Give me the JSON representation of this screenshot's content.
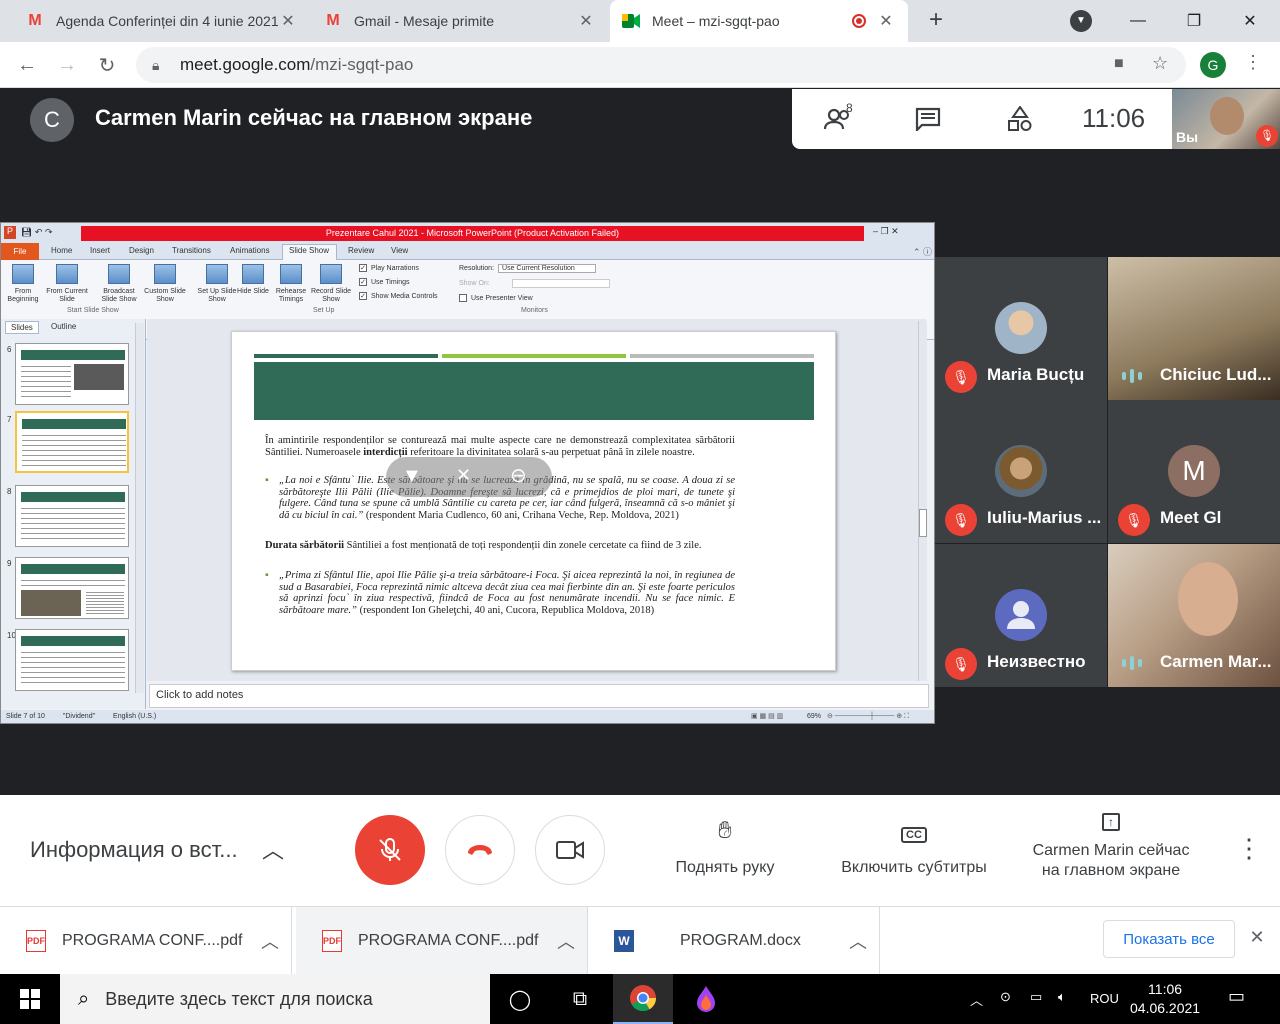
{
  "browser": {
    "tabs": [
      {
        "title": "Agenda Conferinței din 4 iunie 2021",
        "icon": "gmail-icon"
      },
      {
        "title": "Gmail - Mesaje primite",
        "icon": "gmail-icon"
      },
      {
        "title": "Meet – mzi-sgqt-pao",
        "icon": "meet-icon",
        "active": true
      }
    ],
    "new_tab": "+",
    "url_host": "meet.google.com",
    "url_path": "/mzi-sgqt-pao",
    "profile_initial": "G"
  },
  "meet": {
    "presenter_initial": "C",
    "presenter_title": "Carmen Marin сейчас на главном экране",
    "participants_count": "8",
    "clock": "11:06",
    "self_label": "Вы",
    "tiles": [
      {
        "name": "Maria Bucțu",
        "muted": true
      },
      {
        "name": "Chiciuc Lud...",
        "muted": false
      },
      {
        "name": "Iuliu-Marius ...",
        "muted": true
      },
      {
        "name": "Meet Gl",
        "initial": "M",
        "muted": true
      },
      {
        "name": "Неизвестно",
        "muted": true
      },
      {
        "name": "Carmen Mar...",
        "muted": false
      }
    ],
    "bottom": {
      "meeting_info": "Информация о вст...",
      "raise_hand": "Поднять руку",
      "captions": "Включить субтитры",
      "presenting": "Carmen Marin сейчас на главном экране"
    }
  },
  "ppt": {
    "title": "Prezentare Cahul 2021 - Microsoft PowerPoint (Product Activation Failed)",
    "file_tab": "File",
    "tabs": [
      "Home",
      "Insert",
      "Design",
      "Transitions",
      "Animations",
      "Slide Show",
      "Review",
      "View"
    ],
    "ribbon": {
      "from_beginning": "From Beginning",
      "from_current": "From Current Slide",
      "broadcast": "Broadcast Slide Show",
      "custom": "Custom Slide Show",
      "group_start": "Start Slide Show",
      "setup": "Set Up Slide Show",
      "hide": "Hide Slide",
      "rehearse": "Rehearse Timings",
      "record": "Record Slide Show",
      "play_narrations": "Play Narrations",
      "use_timings": "Use Timings",
      "show_media": "Show Media Controls",
      "group_setup": "Set Up",
      "resolution_label": "Resolution:",
      "resolution_value": "Use Current Resolution",
      "show_on": "Show On:",
      "presenter_view": "Use Presenter View",
      "group_monitors": "Monitors"
    },
    "panel_tabs": [
      "Slides",
      "Outline"
    ],
    "thumb_numbers": [
      "6",
      "7",
      "8",
      "9",
      "10"
    ],
    "slide": {
      "intro_before": "În amintirile respondenților se conturează mai multe aspecte care ne demonstrează complexitatea sărbătorii Sântiliei. Numeroasele ",
      "intro_bold": "interdicții",
      "intro_after": " referitoare la divinitatea solară s-au perpetuat până în zilele noastre.",
      "quote1": "„La noi e Sfântu` Ilie. Este sărbătoare şi nu se lucrează în grădină, nu se spală, nu se coase. A doua zi se sărbătoreşte Ilii Pălii (Ilie Pălie). Doamne fereşte să lucrezi, că e primejdios de ploi mari, de tunete şi fulgere. Când tuna se spune că umblă Sântilie cu careta pe cer, iar când fulgeră, înseamnă că s-o mâniet şi dă cu biciul în cai.”",
      "quote1_src": " (respondent Maria Cudlenco, 60 ani, Crihana Veche, Rep. Moldova, 2021)",
      "duration_bold": "Durata sărbătorii",
      "duration_text": " Sântiliei a fost menționată de toți respondenții din zonele cercetate ca fiind de 3 zile.",
      "quote2": "„Prima zi Sfântul Ilie, apoi Ilie Pălie şi-a treia sărbătoare-i Foca. Şi aicea reprezintă la noi, în regiunea de sud a Basarabiei, Foca reprezintă nimic altceva decât ziua cea mai fierbinte din an. Şi este foarte periculos să aprinzi focu` în ziua respectivă, fiindcă de Foca au fost nenumărate incendii. Nu se face nimic. E sărbătoare mare.”",
      "quote2_src": " (respondent Ion Gheleţchi, 40 ani, Cucora, Republica Moldova, 2018)"
    },
    "notes_placeholder": "Click to add notes",
    "status_slide": "Slide 7 of 10",
    "status_theme": "\"Dividend\"",
    "status_lang": "English (U.S.)",
    "status_zoom": "69%",
    "colors": {
      "title_bar": "#e81123",
      "slide_header": "#2f6b57",
      "accent_green": "#8dc63f"
    }
  },
  "downloads": {
    "items": [
      {
        "name": "PROGRAMA CONF....pdf",
        "type": "pdf"
      },
      {
        "name": "PROGRAMA CONF....pdf",
        "type": "pdf"
      },
      {
        "name": "PROGRAM.docx",
        "type": "docx"
      }
    ],
    "show_all": "Показать все"
  },
  "taskbar": {
    "search_placeholder": "Введите здесь текст для поиска",
    "lang": "ROU",
    "time": "11:06",
    "date": "04.06.2021"
  },
  "colors": {
    "meet_red": "#ea4335",
    "meet_bg": "#202124",
    "link_blue": "#1a73e8"
  }
}
